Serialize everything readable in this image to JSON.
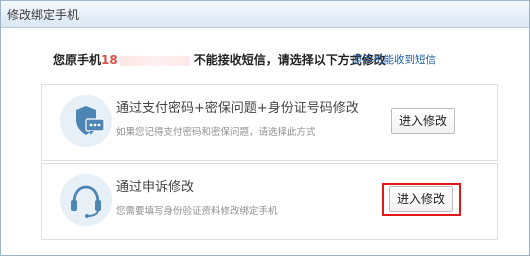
{
  "window": {
    "title": "修改绑定手机"
  },
  "headline": {
    "prefix": "您原手机",
    "phone_visible": "18",
    "suffix": "不能接收短信，请选择以下方式修改"
  },
  "link_text": "原手机能收到短信",
  "options": [
    {
      "title": "通过支付密码+密保问题+身份证号码修改",
      "desc": "如果您记得支付密码和密保问题，请选择此方式",
      "button": "进入修改",
      "icon": "shield-chat-icon"
    },
    {
      "title": "通过申诉修改",
      "desc": "您需要填写身份验证资料修改绑定手机",
      "button": "进入修改",
      "icon": "headset-icon"
    }
  ],
  "colors": {
    "accent": "#1f5fa8",
    "phone": "#d94f45",
    "highlight": "#e01a1a",
    "icon_blue": "#4d86b5"
  }
}
